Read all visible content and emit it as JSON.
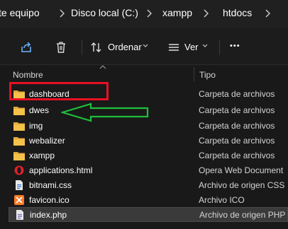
{
  "breadcrumb": {
    "items": [
      "te equipo",
      "Disco local (C:)",
      "xampp",
      "htdocs"
    ]
  },
  "toolbar": {
    "sort_label": "Ordenar",
    "view_label": "Ver",
    "more_label": "•••"
  },
  "columns": {
    "name": "Nombre",
    "type": "Tipo"
  },
  "files": [
    {
      "name": "dashboard",
      "type": "Carpeta de archivos",
      "icon": "folder-icon"
    },
    {
      "name": "dwes",
      "type": "Carpeta de archivos",
      "icon": "folder-icon"
    },
    {
      "name": "img",
      "type": "Carpeta de archivos",
      "icon": "folder-icon"
    },
    {
      "name": "webalizer",
      "type": "Carpeta de archivos",
      "icon": "folder-icon"
    },
    {
      "name": "xampp",
      "type": "Carpeta de archivos",
      "icon": "folder-icon"
    },
    {
      "name": "applications.html",
      "type": "Opera Web Document",
      "icon": "opera-icon"
    },
    {
      "name": "bitnami.css",
      "type": "Archivo de origen CSS",
      "icon": "css-file-icon"
    },
    {
      "name": "favicon.ico",
      "type": "Archivo ICO",
      "icon": "xampp-ico-icon"
    },
    {
      "name": "index.php",
      "type": "Archivo de origen PHP",
      "icon": "php-file-icon",
      "selected": true
    }
  ],
  "colors": {
    "background": "#191919",
    "selected_row": "#3a3a3a",
    "folder": "#f4c14b",
    "annotation_box": "#e81123",
    "annotation_arrow": "#1fbf3a"
  }
}
